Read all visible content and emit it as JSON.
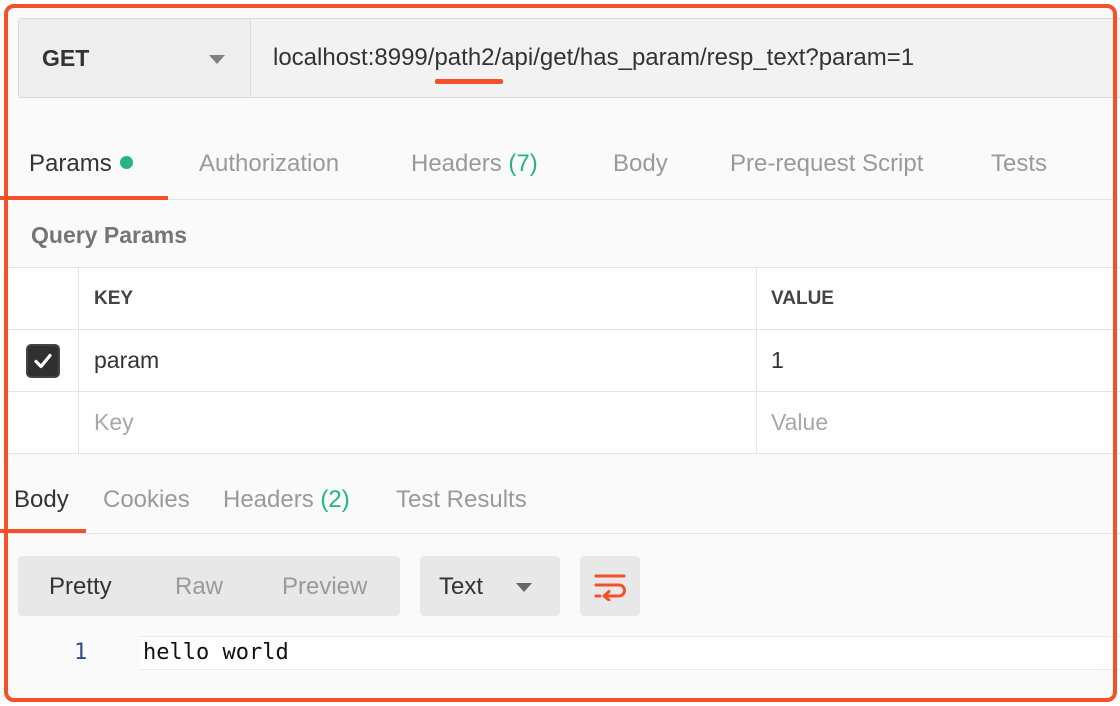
{
  "request": {
    "method": "GET",
    "url": "localhost:8999/path2/api/get/has_param/resp_text?param=1"
  },
  "request_tabs": {
    "params": "Params",
    "authorization": "Authorization",
    "headers": "Headers",
    "headers_count": "(7)",
    "body": "Body",
    "prerequest": "Pre-request Script",
    "tests": "Tests"
  },
  "query_params": {
    "title": "Query Params",
    "columns": {
      "key": "KEY",
      "value": "VALUE"
    },
    "rows": [
      {
        "checked": true,
        "key": "param",
        "value": "1"
      }
    ],
    "new_row": {
      "key_placeholder": "Key",
      "value_placeholder": "Value"
    }
  },
  "response_tabs": {
    "body": "Body",
    "cookies": "Cookies",
    "headers": "Headers",
    "headers_count": "(2)",
    "test_results": "Test Results"
  },
  "response_view": {
    "modes": [
      "Pretty",
      "Raw",
      "Preview"
    ],
    "active_mode": "Pretty",
    "format": "Text",
    "wrap_icon": "wrap-lines-icon"
  },
  "response_body": {
    "lines": [
      {
        "number": "1",
        "text": "hello world"
      }
    ]
  },
  "colors": {
    "accent": "#f4502a",
    "success": "#26b47f"
  }
}
